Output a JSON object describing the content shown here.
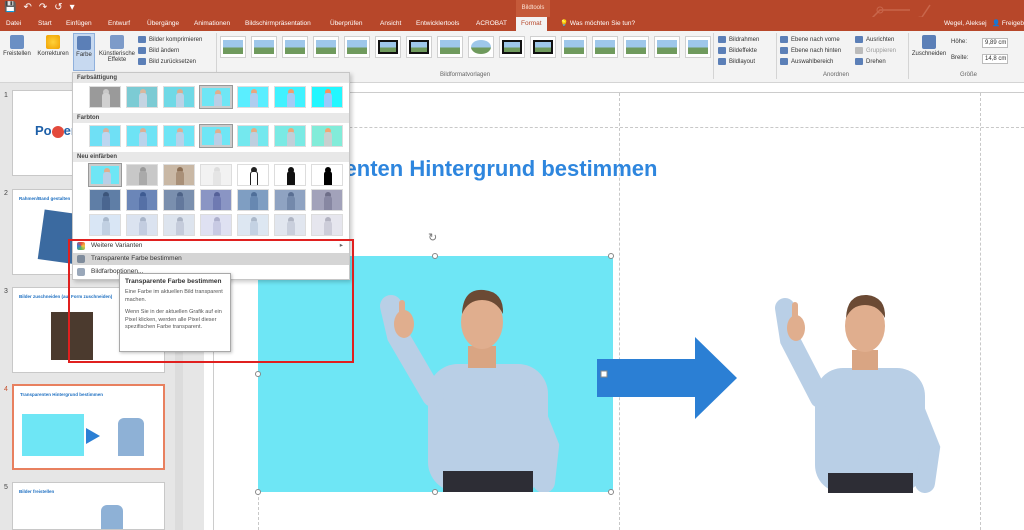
{
  "window": {
    "context_tab": "Bildtools",
    "tabs": [
      "Datei",
      "Start",
      "Einfügen",
      "Entwurf",
      "Übergänge",
      "Animationen",
      "Bildschirmpräsentation",
      "Überprüfen",
      "Ansicht",
      "Entwicklertools",
      "ACROBAT",
      "Format"
    ],
    "active_tab": "Format",
    "tell_me": "Was möchten Sie tun?",
    "user": "Wegel, Aleksej",
    "share": "Freigeb"
  },
  "ribbon": {
    "freistellen": "Freistellen",
    "korrekturen": "Korrekturen",
    "farbe": "Farbe",
    "kuenstlerische_effekte": "Künstlerische Effekte",
    "bilder_komprimieren": "Bilder komprimieren",
    "bild_aendern": "Bild ändern",
    "bild_zuruecksetzen": "Bild zurücksetzen",
    "group_bildformatvorlagen": "Bildformatvorlagen",
    "bildrahmen": "Bildrahmen",
    "bildeffekte": "Bildeffekte",
    "bildlayout": "Bildlayout",
    "ebene_vorne": "Ebene nach vorne",
    "ebene_hinten": "Ebene nach hinten",
    "auswahlbereich": "Auswahlbereich",
    "ausrichten": "Ausrichten",
    "gruppieren": "Gruppieren",
    "drehen": "Drehen",
    "group_anordnen": "Anordnen",
    "zuschneiden": "Zuschneiden",
    "hoehe_label": "Höhe:",
    "hoehe_value": "9,89 cm",
    "breite_label": "Breite:",
    "breite_value": "14,8 cm",
    "group_groesse": "Größe"
  },
  "color_menu": {
    "section_saturation": "Farbsättigung",
    "section_tone": "Farbton",
    "section_recolor": "Neu einfärben",
    "more_variants": "Weitere Varianten",
    "set_transparent": "Transparente Farbe bestimmen",
    "picture_color_options": "Bildfarboptionen..."
  },
  "tooltip": {
    "title": "Transparente Farbe bestimmen",
    "line1": "Eine Farbe im aktuellen Bild transparent machen.",
    "line2": "Wenn Sie in der aktuellen Grafik auf ein Pixel klicken, werden alle Pixel dieser spezifischen Farbe transparent."
  },
  "slides": {
    "numbers": [
      "1",
      "2",
      "3",
      "4",
      "5"
    ],
    "titles": [
      "",
      "Rahmen/Band gestalten",
      "Bilder zuschneiden (auf Form zuschneiden)",
      "Transparenten Hintergrund bestimmen",
      "Bilder freistellen"
    ],
    "slide1_logo_a": "Po",
    "slide1_logo_b": "er"
  },
  "slide_main": {
    "heading": "renten Hintergrund bestimmen"
  },
  "colors": {
    "accent": "#b7472a",
    "heading": "#2e86de",
    "cyan_bg": "#6ee6f5",
    "arrow": "#2b7fd4",
    "highlight_box": "#e0201f"
  }
}
